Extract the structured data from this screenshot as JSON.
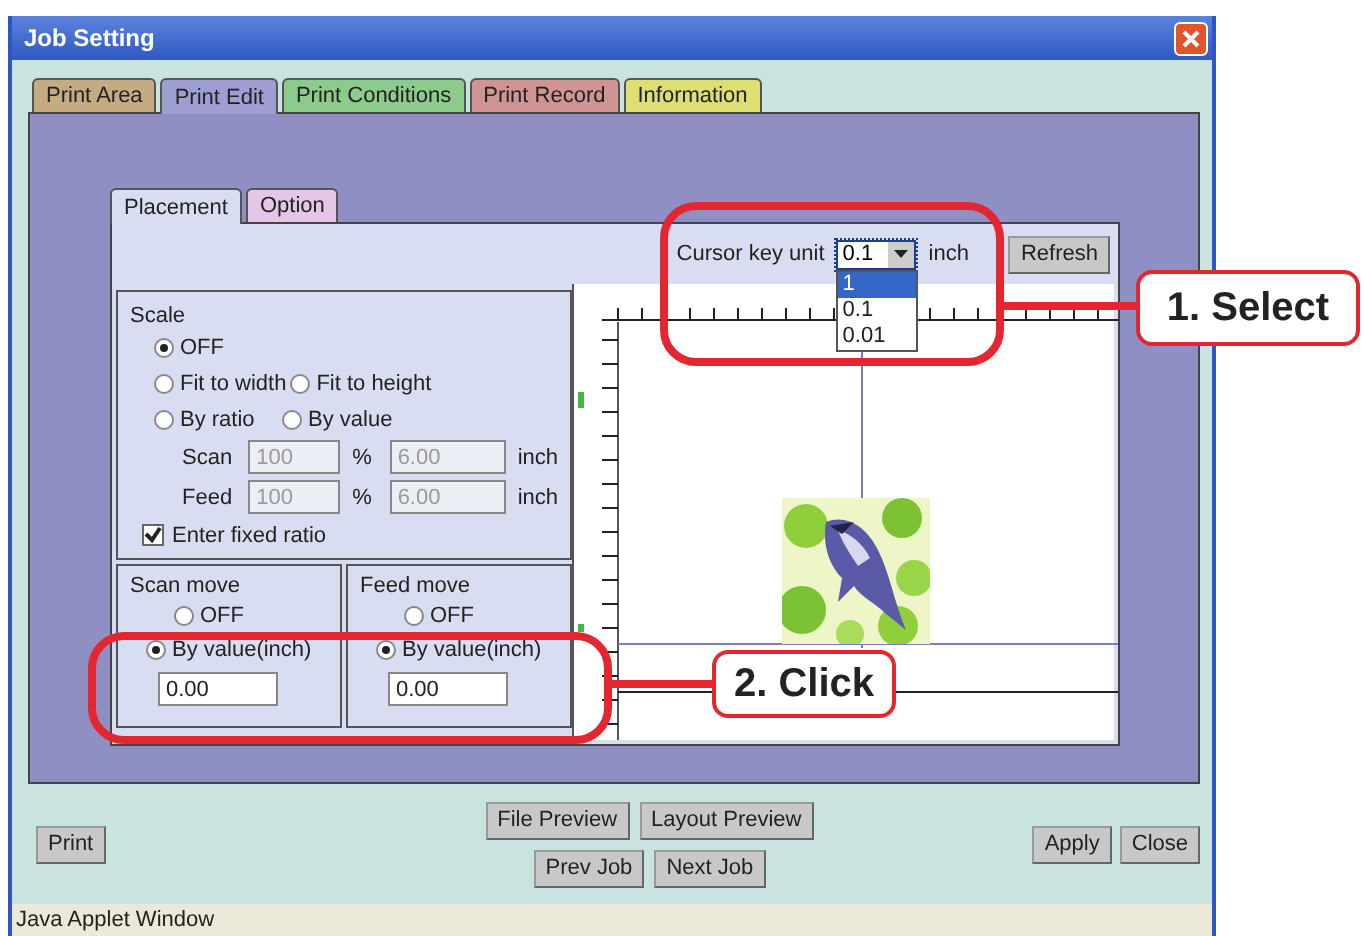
{
  "window": {
    "title": "Job Setting"
  },
  "tabs": [
    {
      "label": "Print Area",
      "selected": false,
      "color": "#c4ab82"
    },
    {
      "label": "Print Edit",
      "selected": true,
      "color": "#9e9ed2"
    },
    {
      "label": "Print Conditions",
      "selected": false,
      "color": "#8ccb8c"
    },
    {
      "label": "Print Record",
      "selected": false,
      "color": "#d09494"
    },
    {
      "label": "Information",
      "selected": false,
      "color": "#dede72"
    }
  ],
  "subtabs": [
    {
      "label": "Placement",
      "selected": true,
      "color": "#d9ddf1"
    },
    {
      "label": "Option",
      "selected": false,
      "color": "#e6c6e6"
    }
  ],
  "cursor_key_unit": {
    "label": "Cursor key unit",
    "value": "0.1",
    "unit": "inch",
    "expanded": true,
    "options": [
      {
        "label": "1",
        "highlighted": true
      },
      {
        "label": "0.1",
        "highlighted": false
      },
      {
        "label": "0.01",
        "highlighted": false
      }
    ]
  },
  "refresh_button": "Refresh",
  "scale": {
    "title": "Scale",
    "option_rows": [
      [
        {
          "label": "OFF",
          "selected": true
        }
      ],
      [
        {
          "label": "Fit to width",
          "selected": false
        },
        {
          "label": "Fit to height",
          "selected": false
        }
      ],
      [
        {
          "label": "By ratio",
          "selected": false
        },
        {
          "label": "By value",
          "selected": false
        }
      ]
    ],
    "fields": [
      {
        "label": "Scan",
        "percent": "100",
        "percent_unit": "%",
        "value": "6.00",
        "unit": "inch",
        "disabled": true
      },
      {
        "label": "Feed",
        "percent": "100",
        "percent_unit": "%",
        "value": "6.00",
        "unit": "inch",
        "disabled": true
      }
    ],
    "fixed_ratio": {
      "label": "Enter fixed ratio",
      "checked": true
    }
  },
  "moves": [
    {
      "title": "Scan move",
      "options": [
        {
          "label": "OFF",
          "selected": false
        },
        {
          "label": "By value(inch)",
          "selected": true
        }
      ],
      "value": "0.00"
    },
    {
      "title": "Feed move",
      "options": [
        {
          "label": "OFF",
          "selected": false
        },
        {
          "label": "By value(inch)",
          "selected": true
        }
      ],
      "value": "0.00"
    }
  ],
  "buttons": {
    "left": [
      "Print"
    ],
    "center_rows": [
      [
        "File Preview",
        "Layout Preview"
      ],
      [
        "Prev Job",
        "Next Job"
      ]
    ],
    "right": [
      "Apply",
      "Close"
    ]
  },
  "status_bar": "Java Applet Window",
  "annotations": [
    {
      "label": "1. Select"
    },
    {
      "label": "2. Click"
    }
  ]
}
